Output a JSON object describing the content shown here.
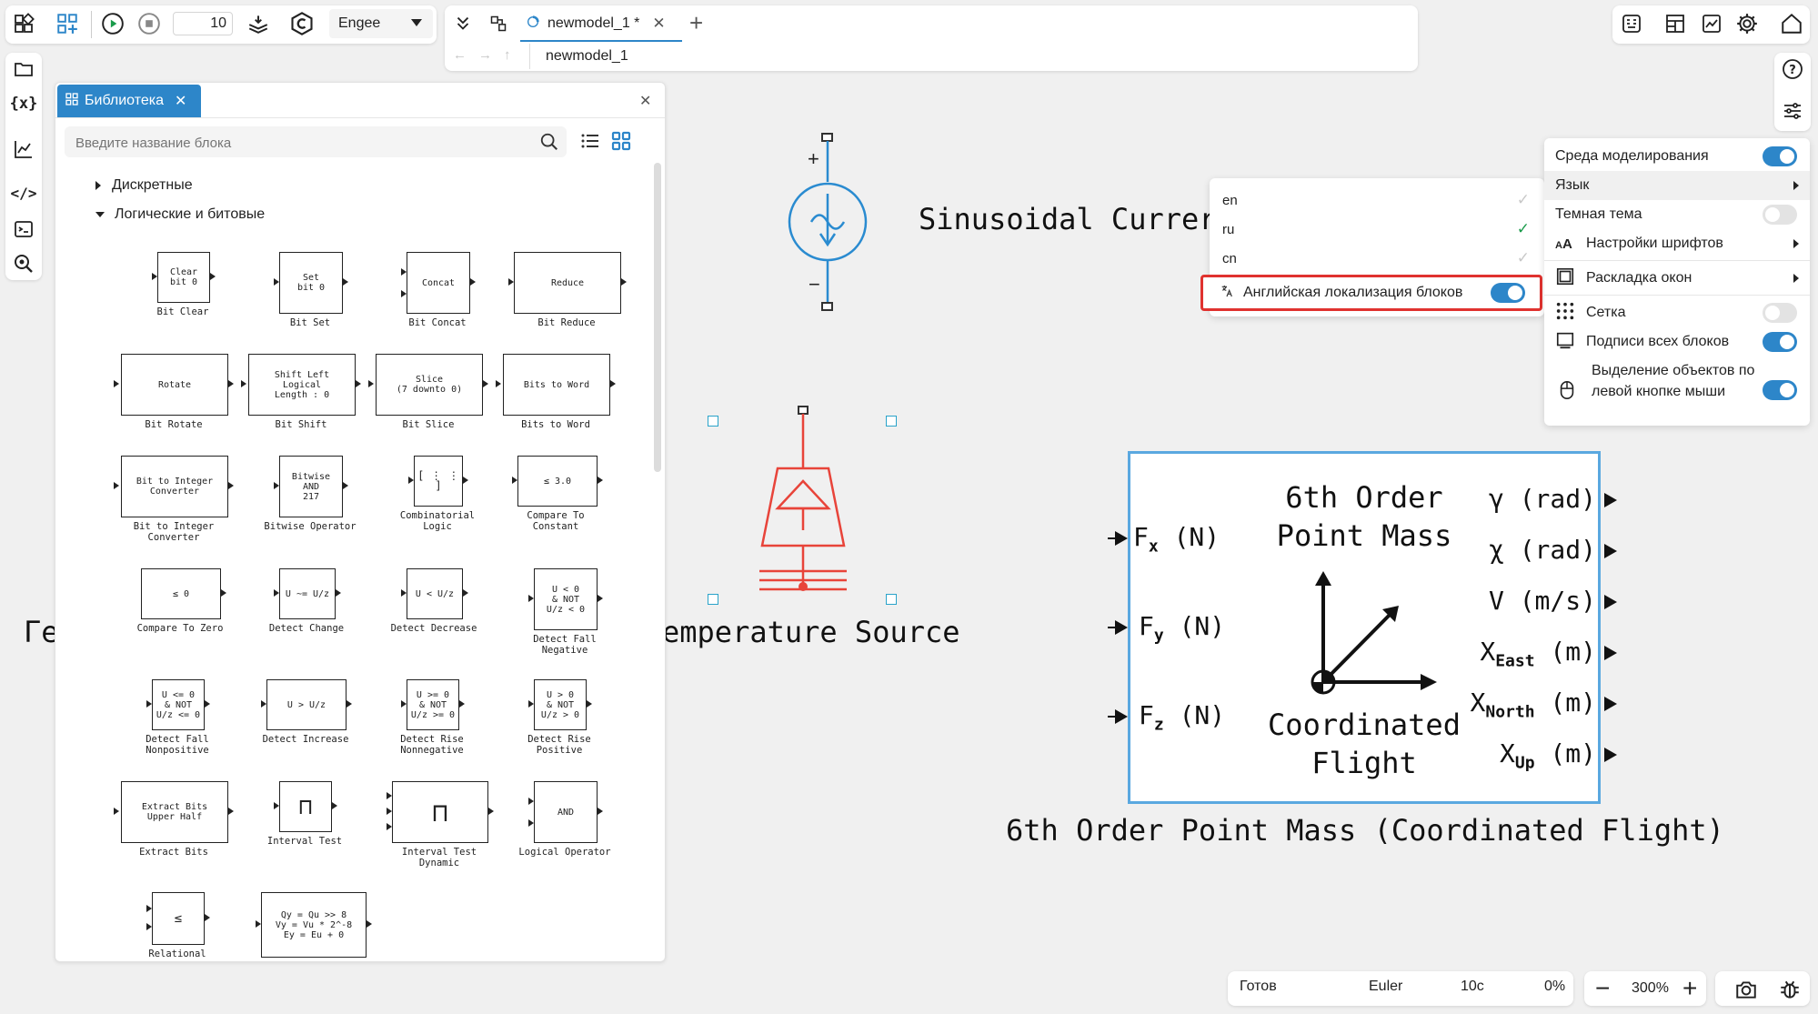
{
  "toolbar": {
    "step_value": "10",
    "engine": "Engee",
    "tab_title": "newmodel_1 *",
    "breadcrumb": "newmodel_1"
  },
  "library": {
    "title": "Библиотека",
    "search_placeholder": "Введите название блока",
    "tree": [
      {
        "label": "Дискретные",
        "expanded": false
      },
      {
        "label": "Логические и битовые",
        "expanded": true
      }
    ],
    "blocks": [
      {
        "inner": "Clear\nbit 0",
        "label": "Bit Clear"
      },
      {
        "inner": "Set\nbit 0",
        "label": "Bit Set"
      },
      {
        "inner": "Concat",
        "label": "Bit Concat"
      },
      {
        "inner": "Reduce",
        "label": "Bit Reduce"
      },
      {
        "inner": "Rotate",
        "label": "Bit Rotate"
      },
      {
        "inner": "Shift Left\nLogical\nLength : 0",
        "label": "Bit Shift"
      },
      {
        "inner": "Slice\n(7 downto 0)",
        "label": "Bit Slice"
      },
      {
        "inner": "Bits to Word",
        "label": "Bits to Word"
      },
      {
        "inner": "Bit to Integer\nConverter",
        "label": "Bit to Integer\nConverter"
      },
      {
        "inner": "Bitwise\nAND\n217",
        "label": "Bitwise Operator"
      },
      {
        "inner": "[ ⋮ ⋮ ]",
        "label": "Combinatorial\nLogic"
      },
      {
        "inner": "≤ 3.0",
        "label": "Compare To\nConstant"
      },
      {
        "inner": "≤ 0",
        "label": "Compare To Zero"
      },
      {
        "inner": "U ~= U/z",
        "label": "Detect Change"
      },
      {
        "inner": "U < U/z",
        "label": "Detect Decrease"
      },
      {
        "inner": "U < 0\n& NOT\nU/z < 0",
        "label": "Detect Fall\nNegative"
      },
      {
        "inner": "U <= 0\n& NOT\nU/z <= 0",
        "label": "Detect Fall\nNonpositive"
      },
      {
        "inner": "U > U/z",
        "label": "Detect Increase"
      },
      {
        "inner": "U >= 0\n& NOT\nU/z >= 0",
        "label": "Detect Rise\nNonnegative"
      },
      {
        "inner": "U > 0\n& NOT\nU/z > 0",
        "label": "Detect Rise\nPositive"
      },
      {
        "inner": "Extract Bits\nUpper Half",
        "label": "Extract Bits"
      },
      {
        "inner": "⊓",
        "label": "Interval Test"
      },
      {
        "inner": "⊓",
        "label": "Interval Test\nDynamic"
      },
      {
        "inner": "AND",
        "label": "Logical Operator"
      },
      {
        "inner": "≤",
        "label": "Relational"
      },
      {
        "inner": "Qy = Qu >> 8\nVy = Vu * 2^-8\nEy = Eu + 0",
        "label": ""
      }
    ]
  },
  "canvas": {
    "sinusoidal_label": "Sinusoidal Currer",
    "temperature_label": "emperature Source",
    "left_partial_label": "Ге",
    "plus": "+",
    "minus": "−",
    "pointmass": {
      "title_line1": "6th Order",
      "title_line2": "Point Mass",
      "bottom_line1": "Coordinated",
      "bottom_line2": "Flight",
      "inputs": [
        {
          "main": "F",
          "sub": "x",
          "unit": "(N)"
        },
        {
          "main": "F",
          "sub": "y",
          "unit": "(N)"
        },
        {
          "main": "F",
          "sub": "z",
          "unit": "(N)"
        }
      ],
      "outputs": [
        {
          "main": "γ",
          "sub": "",
          "unit": "(rad)"
        },
        {
          "main": "χ",
          "sub": "",
          "unit": "(rad)"
        },
        {
          "main": "V",
          "sub": "",
          "unit": "(m/s)"
        },
        {
          "main": "X",
          "sub": "East",
          "unit": "(m)"
        },
        {
          "main": "X",
          "sub": "North",
          "unit": "(m)"
        },
        {
          "main": "X",
          "sub": "Up",
          "unit": "(m)"
        }
      ],
      "caption": "6th Order Point Mass (Coordinated Flight)"
    }
  },
  "language_menu": {
    "items": [
      {
        "code": "en",
        "checked": false
      },
      {
        "code": "ru",
        "checked": true
      },
      {
        "code": "cn",
        "checked": false
      }
    ],
    "english_blocks_label": "Английская локализация блоков",
    "english_blocks_on": true
  },
  "settings_menu": {
    "items": [
      {
        "label": "Среда моделирования",
        "control": "toggle",
        "on": true
      },
      {
        "label": "Язык",
        "control": "arrow"
      },
      {
        "label": "Темная тема",
        "control": "toggle",
        "on": false
      },
      {
        "label": "Настройки шрифтов",
        "control": "arrow"
      },
      {
        "label": "Раскладка окон",
        "control": "arrow"
      },
      {
        "label": "Сетка",
        "control": "toggle",
        "on": false
      },
      {
        "label": "Подписи всех блоков",
        "control": "toggle",
        "on": true
      },
      {
        "label": "Выделение объектов по левой кнопке мыши",
        "control": "toggle",
        "on": true
      }
    ]
  },
  "status": {
    "state": "Готов",
    "solver": "Euler",
    "time": "10с",
    "progress": "0%",
    "zoom": "300%"
  },
  "colors": {
    "accent": "#2d86c9",
    "highlight_border": "#e0322f",
    "temp_source": "#e8443a",
    "sin_source": "#2a8bd0",
    "selection_box": "#5aa8e0"
  }
}
